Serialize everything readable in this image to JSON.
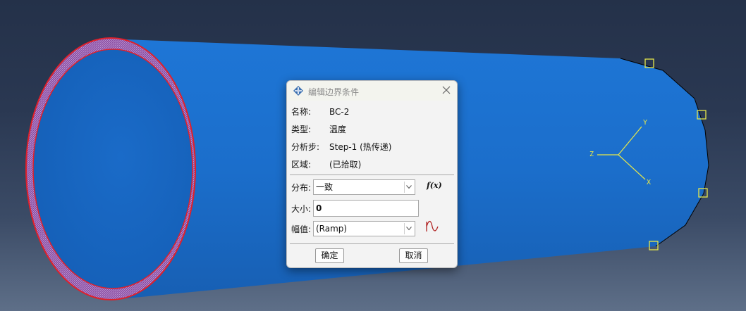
{
  "dialog": {
    "title": "编辑边界条件",
    "info": [
      {
        "label": "名称:",
        "value": "BC-2"
      },
      {
        "label": "类型:",
        "value": "温度"
      },
      {
        "label": "分析步:",
        "value": "Step-1 (热传递)"
      },
      {
        "label": "区域:",
        "value": "(已拾取)"
      }
    ],
    "distribution": {
      "label": "分布:",
      "value": "一致"
    },
    "magnitude": {
      "label": "大小:",
      "value": "0"
    },
    "amplitude": {
      "label": "幅值:",
      "value": "(Ramp)"
    },
    "fx_label": "f(x)",
    "ok_label": "确定",
    "cancel_label": "取消"
  },
  "triad": {
    "x": "X",
    "y": "Y",
    "z": "Z"
  },
  "colors": {
    "part_blue": "#1a6fd0",
    "inner_blue": "#1466c2",
    "highlight_red": "#e0202a",
    "triad_yellow": "#e8e84a"
  }
}
